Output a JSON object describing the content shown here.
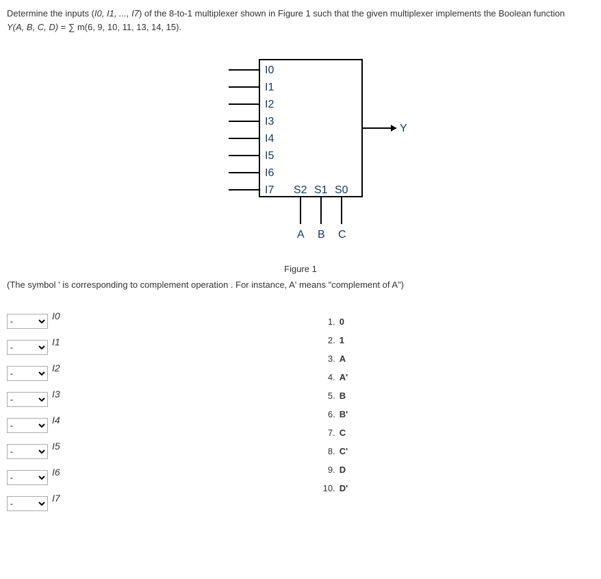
{
  "question": {
    "prefix": "Determine the inputs (",
    "inputs": "I0, I1, ..., I7",
    "mid": ") of the 8-to-1 multiplexer shown in Figure 1 such that the given multiplexer implements the Boolean function"
  },
  "equation": {
    "lhs": "Y(A, B, C, D)",
    "eq": " = ∑ m(6, 9, 10, 11, 13, 14, 15)."
  },
  "figure": {
    "input_labels": [
      "I0",
      "I1",
      "I2",
      "I3",
      "I4",
      "I5",
      "I6",
      "I7"
    ],
    "select_labels": [
      "S2",
      "S1",
      "S0"
    ],
    "bot_labels": [
      "A",
      "B",
      "C"
    ],
    "output": "Y",
    "caption": "Figure 1"
  },
  "note": "(The symbol   ' is corresponding to complement operation . For instance, A'  means \"complement of A\")",
  "left_inputs": [
    {
      "label": "I0",
      "value": "-"
    },
    {
      "label": "I1",
      "value": "-"
    },
    {
      "label": "I2",
      "value": "-"
    },
    {
      "label": "I3",
      "value": "-"
    },
    {
      "label": "I4",
      "value": "-"
    },
    {
      "label": "I5",
      "value": "-"
    },
    {
      "label": "I6",
      "value": "-"
    },
    {
      "label": "I7",
      "value": "-"
    }
  ],
  "options": [
    {
      "num": "1.",
      "val": "0"
    },
    {
      "num": "2.",
      "val": "1"
    },
    {
      "num": "3.",
      "val": "A"
    },
    {
      "num": "4.",
      "val": "A'"
    },
    {
      "num": "5.",
      "val": "B"
    },
    {
      "num": "6.",
      "val": "B'"
    },
    {
      "num": "7.",
      "val": "C"
    },
    {
      "num": "8.",
      "val": "C'"
    },
    {
      "num": "9.",
      "val": "D"
    },
    {
      "num": "10.",
      "val": "D'"
    }
  ]
}
